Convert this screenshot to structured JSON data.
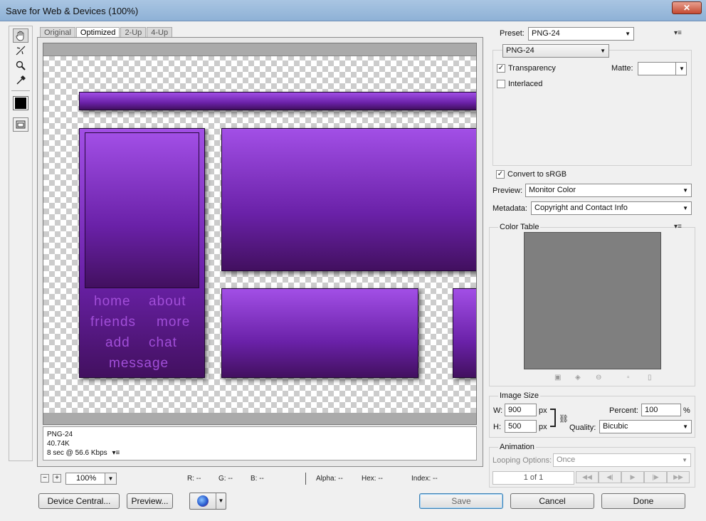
{
  "window": {
    "title": "Save for Web & Devices (100%)",
    "close": "✕"
  },
  "tabs": [
    {
      "label": "Original",
      "active": false
    },
    {
      "label": "Optimized",
      "active": true
    },
    {
      "label": "2-Up",
      "active": false
    },
    {
      "label": "4-Up",
      "active": false
    }
  ],
  "preview": {
    "nav_text": [
      "home",
      "about",
      "friends",
      "more",
      "add",
      "chat",
      "message"
    ]
  },
  "info": {
    "format": "PNG-24",
    "size": "40.74K",
    "time": "8 sec @ 56.6 Kbps"
  },
  "status": {
    "zoom": "100%",
    "r": "R: --",
    "g": "G: --",
    "b": "B: --",
    "alpha": "Alpha: --",
    "hex": "Hex: --",
    "index": "Index: --"
  },
  "settings": {
    "preset_label": "Preset:",
    "preset_value": "PNG-24",
    "format_value": "PNG-24",
    "transparency_label": "Transparency",
    "transparency_checked": "✓",
    "matte_label": "Matte:",
    "interlaced_label": "Interlaced",
    "convert_label": "Convert to sRGB",
    "convert_checked": "✓",
    "preview_label": "Preview:",
    "preview_value": "Monitor Color",
    "metadata_label": "Metadata:",
    "metadata_value": "Copyright and Contact Info"
  },
  "color_table": {
    "title": "Color Table"
  },
  "image_size": {
    "title": "Image Size",
    "w_label": "W:",
    "w_value": "900",
    "w_unit": "px",
    "h_label": "H:",
    "h_value": "500",
    "h_unit": "px",
    "percent_label": "Percent:",
    "percent_value": "100",
    "percent_unit": "%",
    "quality_label": "Quality:",
    "quality_value": "Bicubic"
  },
  "animation": {
    "title": "Animation",
    "looping_label": "Looping Options:",
    "looping_value": "Once",
    "frame": "1 of 1"
  },
  "buttons": {
    "device_central": "Device Central...",
    "preview": "Preview...",
    "save": "Save",
    "cancel": "Cancel",
    "done": "Done"
  }
}
